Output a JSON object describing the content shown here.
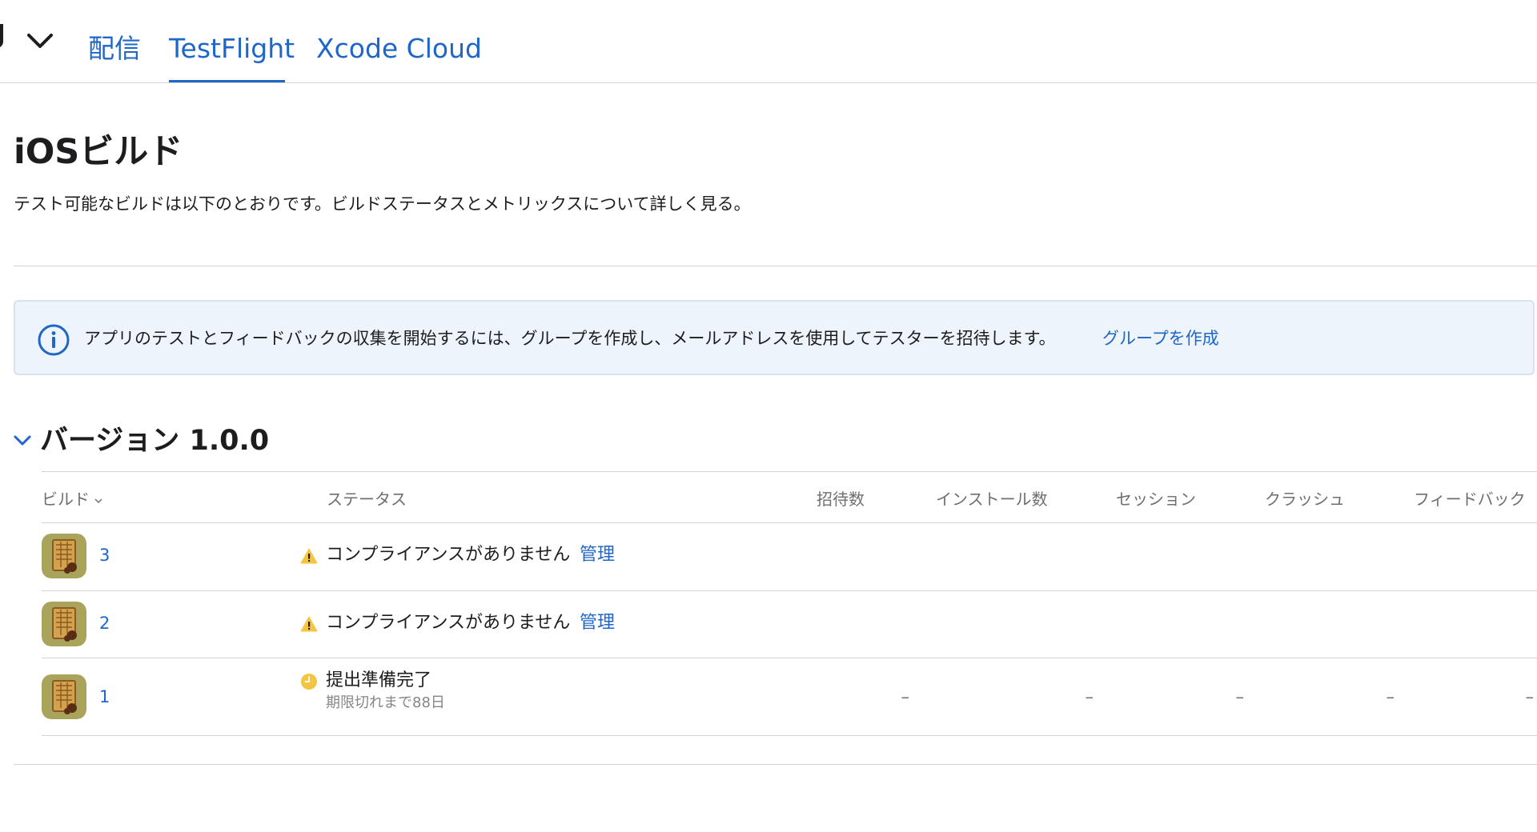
{
  "nav": {
    "tabs": [
      {
        "label": "配信"
      },
      {
        "label": "TestFlight"
      },
      {
        "label": "Xcode Cloud"
      }
    ],
    "active_tab": "TestFlight"
  },
  "header": {
    "title": "iOSビルド",
    "subtitle": "テスト可能なビルドは以下のとおりです。ビルドステータスとメトリックスについて詳しく見る。"
  },
  "banner": {
    "text": "アプリのテストとフィードバックの収集を開始するには、グループを作成し、メールアドレスを使用してテスターを招待します。",
    "link": "グループを作成",
    "icon": "info-circle-icon"
  },
  "version": {
    "title": "バージョン 1.0.0",
    "expanded": true
  },
  "table": {
    "columns": {
      "build": "ビルド",
      "status": "ステータス",
      "invites": "招待数",
      "installs": "インストール数",
      "sessions": "セッション",
      "crashes": "クラッシュ",
      "feedback": "フィードバック"
    },
    "rows": [
      {
        "build": "3",
        "status": "コンプライアンスがありません",
        "status_icon": "warning-triangle-icon",
        "action": "管理"
      },
      {
        "build": "2",
        "status": "コンプライアンスがありません",
        "status_icon": "warning-triangle-icon",
        "action": "管理"
      },
      {
        "build": "1",
        "status": "提出準備完了",
        "status_icon": "clock-icon",
        "substatus": "期限切れまで88日",
        "invites": "–",
        "installs": "–",
        "sessions": "–",
        "crashes": "–",
        "feedback": "–"
      }
    ]
  },
  "colors": {
    "accent": "#1e66c7",
    "warning": "#f5c542",
    "banner_bg": "#eef4fb"
  }
}
